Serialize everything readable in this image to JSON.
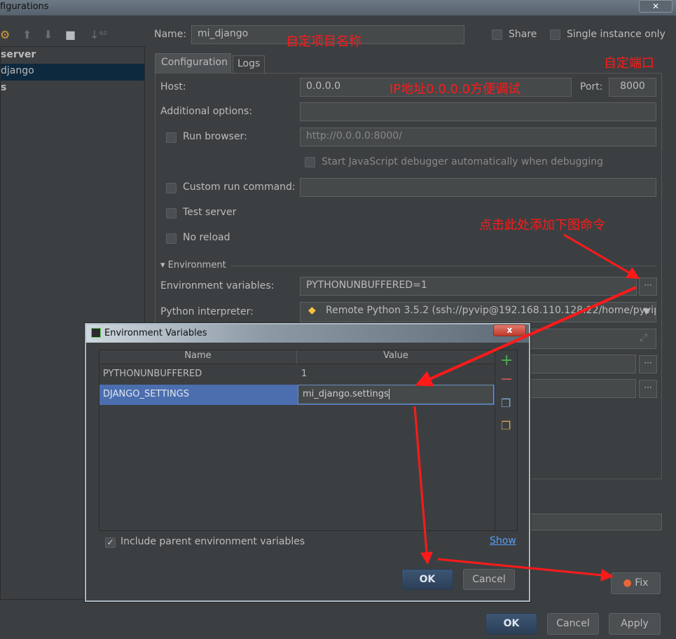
{
  "window": {
    "title": "figurations",
    "close": "✕"
  },
  "sidebar": {
    "items": [
      {
        "label": "server"
      },
      {
        "label": "django"
      },
      {
        "label": "s"
      }
    ]
  },
  "header": {
    "name_label": "Name:",
    "name_value": "mi_django",
    "share": "Share",
    "single_instance": "Single instance only"
  },
  "tabs": [
    {
      "label": "Configuration"
    },
    {
      "label": "Logs"
    }
  ],
  "config": {
    "host_label": "Host:",
    "host_value": "0.0.0.0",
    "port_label": "Port:",
    "port_value": "8000",
    "additional_label": "Additional options:",
    "additional_value": "",
    "run_browser_label": "Run browser:",
    "run_browser_value": "http://0.0.0.0:8000/",
    "js_debugger": "Start JavaScript debugger automatically when debugging",
    "custom_run": "Custom run command:",
    "test_server": "Test server",
    "no_reload": "No reload",
    "env_section": "Environment",
    "env_vars_label": "Environment variables:",
    "env_vars_value": "PYTHONUNBUFFERED=1",
    "interpreter_label": "Python interpreter:",
    "interpreter_value": "Remote Python 3.5.2 (ssh://pyvip@192.168.110.128:22/home/pyvip/",
    "dots": "···"
  },
  "annotations": {
    "project_name": "自定项目名称",
    "port": "自定端口",
    "ip": "IP地址0.0.0.0方便调试",
    "click_here": "点击此处添加下图命令",
    "color": "#ff1a1a"
  },
  "dialog": {
    "title": "Environment Variables",
    "close": "x",
    "col_name": "Name",
    "col_value": "Value",
    "rows": [
      {
        "name": "PYTHONUNBUFFERED",
        "value": "1"
      },
      {
        "name": "DJANGO_SETTINGS",
        "value": "mi_django.settings"
      }
    ],
    "include_parent": "Include parent environment variables",
    "show": "Show",
    "ok": "OK",
    "cancel": "Cancel"
  },
  "footer": {
    "fix": "Fix",
    "ok": "OK",
    "cancel": "Cancel",
    "apply": "Apply"
  }
}
